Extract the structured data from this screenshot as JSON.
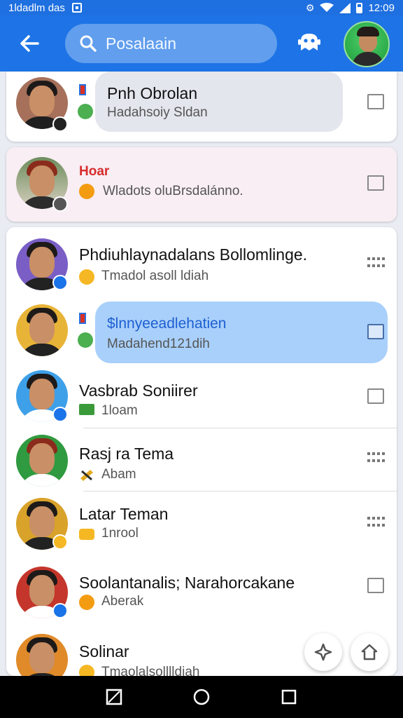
{
  "status_bar": {
    "left_text": "1ldadlm das",
    "time": "12:09"
  },
  "app_bar": {
    "search_text": "Posalaain"
  },
  "conversations": [
    {
      "name": "Pnh Obrolan",
      "preview": "Hadahsoiy Sldan",
      "name_color": "#111111",
      "highlight": "#e4e6ee"
    },
    {
      "name": "Hoar",
      "preview": "Wladots oluBrsdalánno.",
      "name_color": "#d72c2c"
    },
    {
      "name": "Phdiuhlaynadalans Bollomlinge.",
      "preview": "Tmadol asoll ldiah"
    },
    {
      "name": "$lnnyeeadlehatien",
      "preview": "Madahend121dih",
      "name_color": "#1d5fd1",
      "highlight": "#a9d0fb"
    },
    {
      "name": "Vasbrab Soniirer",
      "preview": "1loam"
    },
    {
      "name": "Rasj ra Tema",
      "preview": "Abam"
    },
    {
      "name": "Latar Teman",
      "preview": "1nrool"
    },
    {
      "name": "Soolantanalis; Narahorcakane",
      "preview": "Aberak"
    },
    {
      "name": "Solinar",
      "preview": "Tmaolalsolllldiah"
    }
  ],
  "colors": {
    "primary": "#1e74e6",
    "statusbar": "#1e6fe0",
    "unread_badge": "#1a73e8"
  }
}
